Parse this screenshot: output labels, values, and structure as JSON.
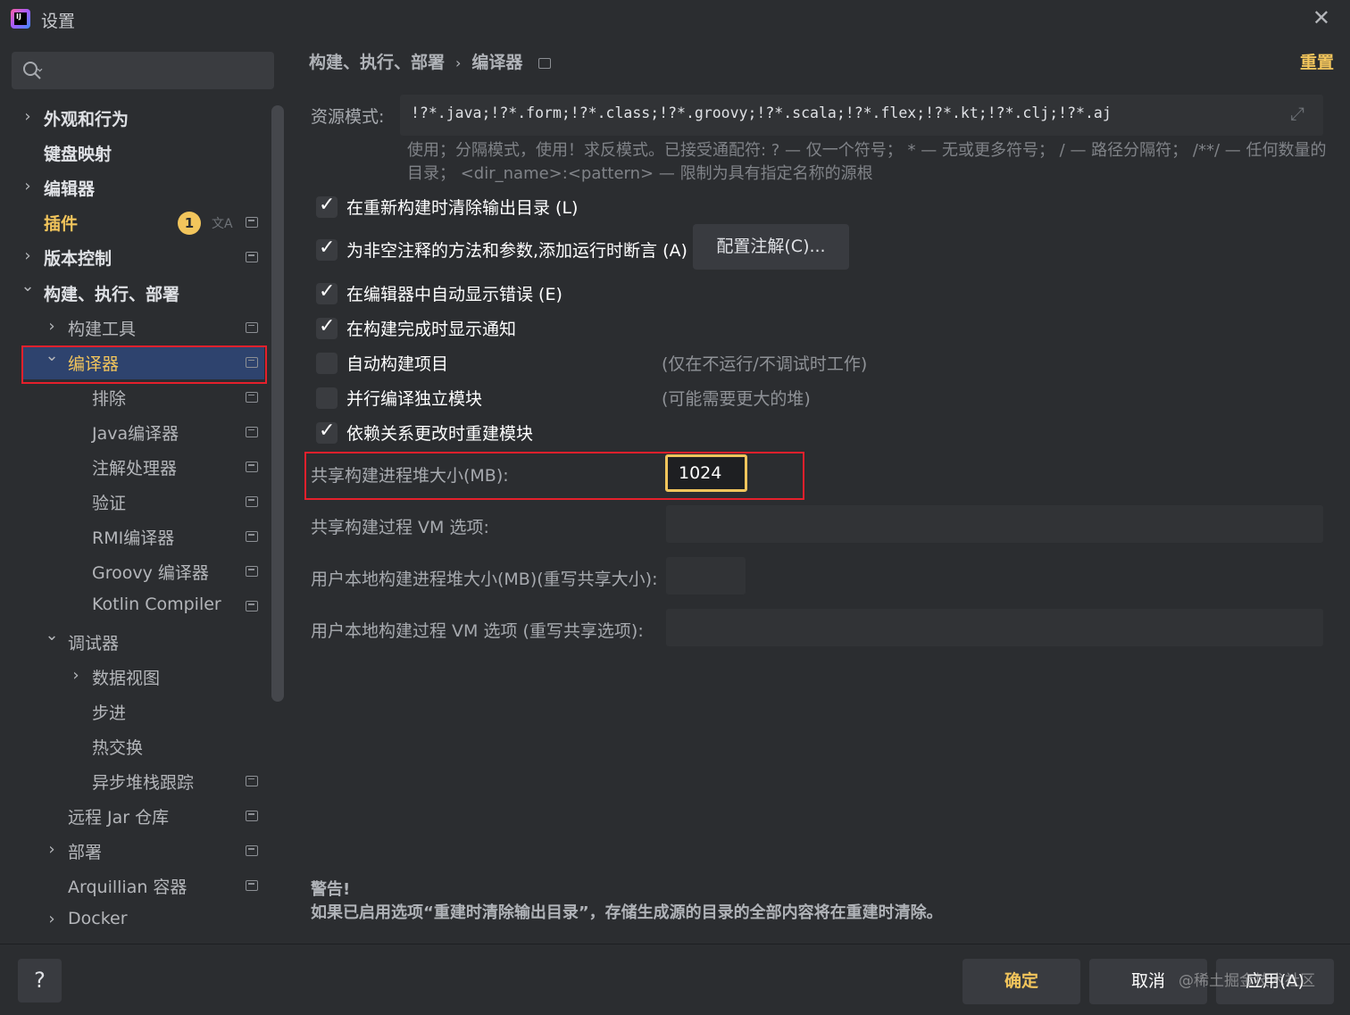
{
  "window": {
    "title": "设置",
    "app_icon": "intellij-idea-icon"
  },
  "search": {
    "placeholder": ""
  },
  "sidebar": {
    "items": [
      {
        "label": "外观和行为",
        "chevron": "›",
        "bold": true
      },
      {
        "label": "键盘映射",
        "chevron": "",
        "bold": true
      },
      {
        "label": "编辑器",
        "chevron": "›",
        "bold": true
      },
      {
        "label": "插件",
        "chevron": "",
        "bold": true,
        "badge": "1",
        "color": "#f2c55c"
      },
      {
        "label": "版本控制",
        "chevron": "›",
        "bold": true
      },
      {
        "label": "构建、执行、部署",
        "chevron": "⌄",
        "bold": true
      },
      {
        "label": "构建工具",
        "chevron": "›"
      },
      {
        "label": "编译器",
        "chevron": "⌄",
        "selected": true
      },
      {
        "label": "排除",
        "chevron": ""
      },
      {
        "label": "Java编译器",
        "chevron": ""
      },
      {
        "label": "注解处理器",
        "chevron": ""
      },
      {
        "label": "验证",
        "chevron": ""
      },
      {
        "label": "RMI编译器",
        "chevron": ""
      },
      {
        "label": "Groovy 编译器",
        "chevron": ""
      },
      {
        "label": "Kotlin Compiler",
        "chevron": ""
      },
      {
        "label": "调试器",
        "chevron": "⌄"
      },
      {
        "label": "数据视图",
        "chevron": "›"
      },
      {
        "label": "步进",
        "chevron": ""
      },
      {
        "label": "热交换",
        "chevron": ""
      },
      {
        "label": "异步堆栈跟踪",
        "chevron": ""
      },
      {
        "label": "远程 Jar 仓库",
        "chevron": ""
      },
      {
        "label": "部署",
        "chevron": "›"
      },
      {
        "label": "Arquillian 容器",
        "chevron": ""
      },
      {
        "label": "Docker",
        "chevron": "›"
      }
    ]
  },
  "breadcrumb": {
    "parent": "构建、执行、部署",
    "separator": "›",
    "current": "编译器"
  },
  "header": {
    "reset_label": "重置"
  },
  "resource": {
    "label": "资源模式:",
    "value": "!?*.java;!?*.form;!?*.class;!?*.groovy;!?*.scala;!?*.flex;!?*.kt;!?*.clj;!?*.aj",
    "hint": "使用；分隔模式，使用！求反模式。已接受通配符: ? — 仅一个符号； * — 无或更多符号； / — 路径分隔符； /**/ — 任何数量的目录； <dir_name>:<pattern> — 限制为具有指定名称的源根"
  },
  "checkboxes": [
    {
      "label": "在重新构建时清除输出目录 (L)",
      "checked": true
    },
    {
      "label": "为非空注释的方法和参数,添加运行时断言 (A)",
      "checked": true
    },
    {
      "label": "在编辑器中自动显示错误 (E)",
      "checked": true
    },
    {
      "label": "在构建完成时显示通知",
      "checked": true
    },
    {
      "label": "自动构建项目",
      "checked": false,
      "note": "(仅在不运行/不调试时工作)"
    },
    {
      "label": "并行编译独立模块",
      "checked": false,
      "note": "(可能需要更大的堆)"
    },
    {
      "label": "依赖关系更改时重建模块",
      "checked": true
    }
  ],
  "config_annotations_button": "配置注解(C)...",
  "form": {
    "shared_heap_label": "共享构建进程堆大小(MB):",
    "shared_heap_value": "1024",
    "shared_vm_label": "共享构建过程 VM 选项:",
    "shared_vm_value": "",
    "user_heap_label": "用户本地构建进程堆大小(MB)(重写共享大小):",
    "user_heap_value": "",
    "user_vm_label": "用户本地构建过程 VM 选项 (重写共享选项):",
    "user_vm_value": ""
  },
  "warning": {
    "title": "警告!",
    "text": "如果已启用选项“重建时清除输出目录”，存储生成源的目录的全部内容将在重建时清除。"
  },
  "footer": {
    "help_label": "?",
    "ok_label": "确定",
    "cancel_label": "取消",
    "apply_label": "应用(A)",
    "watermark": "@稀土掘金技术社区"
  },
  "colors": {
    "accent": "#f2c55c",
    "highlight_box": "#e5202c",
    "background": "#2b2d30"
  }
}
